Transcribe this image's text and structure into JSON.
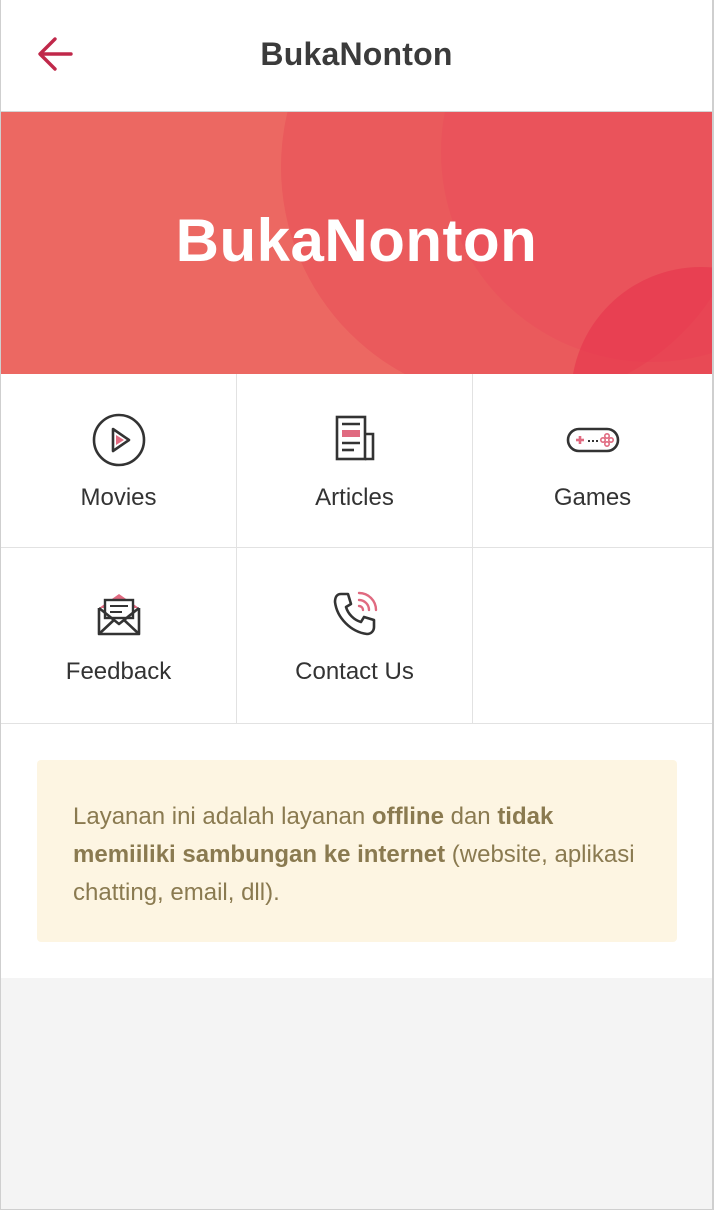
{
  "appbar": {
    "title": "BukaNonton",
    "back_icon": "arrow-left-icon"
  },
  "banner": {
    "logo_text": "BukaNonton"
  },
  "menu": [
    {
      "label": "Movies",
      "icon": "play-circle-icon"
    },
    {
      "label": "Articles",
      "icon": "newspaper-icon"
    },
    {
      "label": "Games",
      "icon": "gamepad-icon"
    },
    {
      "label": "Feedback",
      "icon": "envelope-open-icon"
    },
    {
      "label": "Contact Us",
      "icon": "phone-ringing-icon"
    }
  ],
  "notice": {
    "part1": "Layanan ini adalah layanan ",
    "bold1": "offline",
    "part2": " dan ",
    "bold2": "tidak memiiliki sambungan ke internet",
    "part3": " (website, aplikasi chatting, email, dll)."
  },
  "colors": {
    "accent": "#c0284a",
    "banner": "#ec6862",
    "notice_bg": "#fdf5e2",
    "notice_text": "#8a7a50"
  }
}
